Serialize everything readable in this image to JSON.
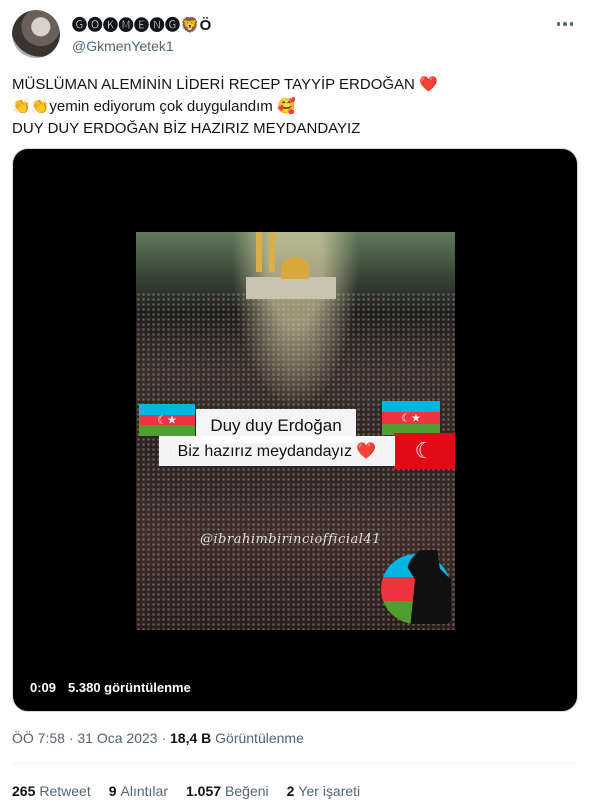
{
  "author": {
    "display_name": "🅖🅞🅚🅜🅔🅝🅖🦁Ö",
    "handle": "@GkmenYetek1"
  },
  "tweet": {
    "lines": [
      "MÜSLÜMAN ALEMİNİN LİDERİ RECEP TAYYİP ERDOĞAN ❤️",
      "👏👏yemin ediyorum çok duygulandım 🥰",
      "DUY DUY ERDOĞAN BİZ HAZIRIZ MEYDANDAYIZ"
    ]
  },
  "video": {
    "overlay_line1": "Duy duy Erdoğan",
    "overlay_line2": "Biz hazırız meydandayız ❤️",
    "watermark": "@ibrahimbirinciofficial41",
    "time": "0:09",
    "views": "5.380 görüntülenme"
  },
  "meta": {
    "time": "ÖÖ 7:58",
    "date": "31 Oca 2023",
    "views_count": "18,4 B",
    "views_label": "Görüntülenme"
  },
  "stats": {
    "retweets_count": "265",
    "retweets_label": "Retweet",
    "quotes_count": "9",
    "quotes_label": "Alıntılar",
    "likes_count": "1.057",
    "likes_label": "Beğeni",
    "bookmarks_count": "2",
    "bookmarks_label": "Yer işareti"
  },
  "icons": {
    "more": "more-horizontal-icon"
  },
  "colors": {
    "text_primary": "#0f1419",
    "text_secondary": "#536471",
    "flag_red": "#e30a17"
  }
}
